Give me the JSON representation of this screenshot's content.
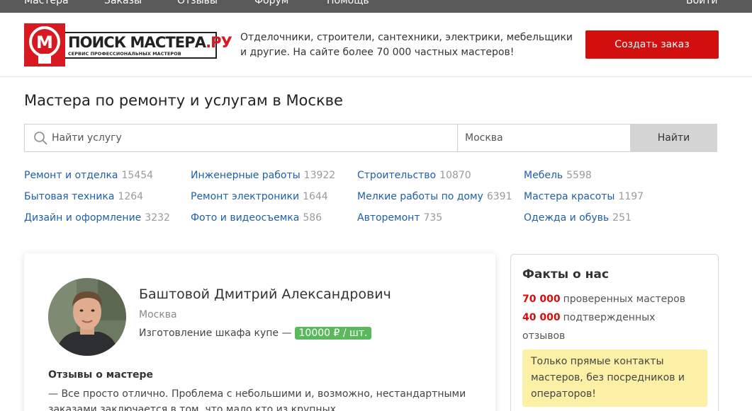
{
  "topnav": {
    "items": [
      "Мастера",
      "Заказы",
      "Отзывы",
      "Форум",
      "Помощь"
    ],
    "login": "Войти"
  },
  "header": {
    "logo_title_main": "ПОИСК МАСТЕРА",
    "logo_title_accent": ".РУ",
    "logo_subtitle": "СЕРВИС ПРОФЕССИОНАЛЬНЫХ МАСТЕРОВ",
    "logo_letter": "М",
    "tagline_line1": "Отделочники, строители, сантехники, электрики, мебельщики",
    "tagline_line2": "и другие. На сайте более 70 000 частных мастеров!",
    "create_order": "Создать заказ"
  },
  "page": {
    "title": "Мастера по ремонту и услугам в Москве"
  },
  "search": {
    "placeholder": "Найти услугу",
    "city": "Москва",
    "button": "Найти"
  },
  "categories": [
    {
      "label": "Ремонт и отделка",
      "count": "15454"
    },
    {
      "label": "Инженерные работы",
      "count": "13922"
    },
    {
      "label": "Строительство",
      "count": "10870"
    },
    {
      "label": "Мебель",
      "count": "5598"
    },
    {
      "label": "Бытовая техника",
      "count": "1264"
    },
    {
      "label": "Ремонт электроники",
      "count": "1644"
    },
    {
      "label": "Мелкие работы по дому",
      "count": "6391"
    },
    {
      "label": "Мастера красоты",
      "count": "1197"
    },
    {
      "label": "Дизайн и оформление",
      "count": "3232"
    },
    {
      "label": "Фото и видеосъемка",
      "count": "586"
    },
    {
      "label": "Авторемонт",
      "count": "735"
    },
    {
      "label": "Одежда и обувь",
      "count": "251"
    }
  ],
  "master": {
    "name": "Баштовой Дмитрий Александрович",
    "city": "Москва",
    "service": "Изготовление шкафа купе —",
    "price": "10000 ₽ / шт.",
    "reviews_title": "Отзывы о мастере",
    "review": "— Все просто отлично. Проблема с небольшими и, возможно, нестандартными заказами заключается в том, что мало кто из крупных"
  },
  "facts": {
    "title": "Факты о нас",
    "stat1_num": "70 000",
    "stat1_text": "проверенных мастеров",
    "stat2_num": "40 000",
    "stat2_text": "подтвержденных",
    "stat2_text2": "отзывов",
    "note": "Только прямые контакты мастеров, без посредников и операторов!"
  },
  "colors": {
    "brand_red": "#d20f0f",
    "link_blue": "#1e5fa8",
    "price_green": "#5cb85c",
    "note_yellow": "#fcf0a6"
  }
}
